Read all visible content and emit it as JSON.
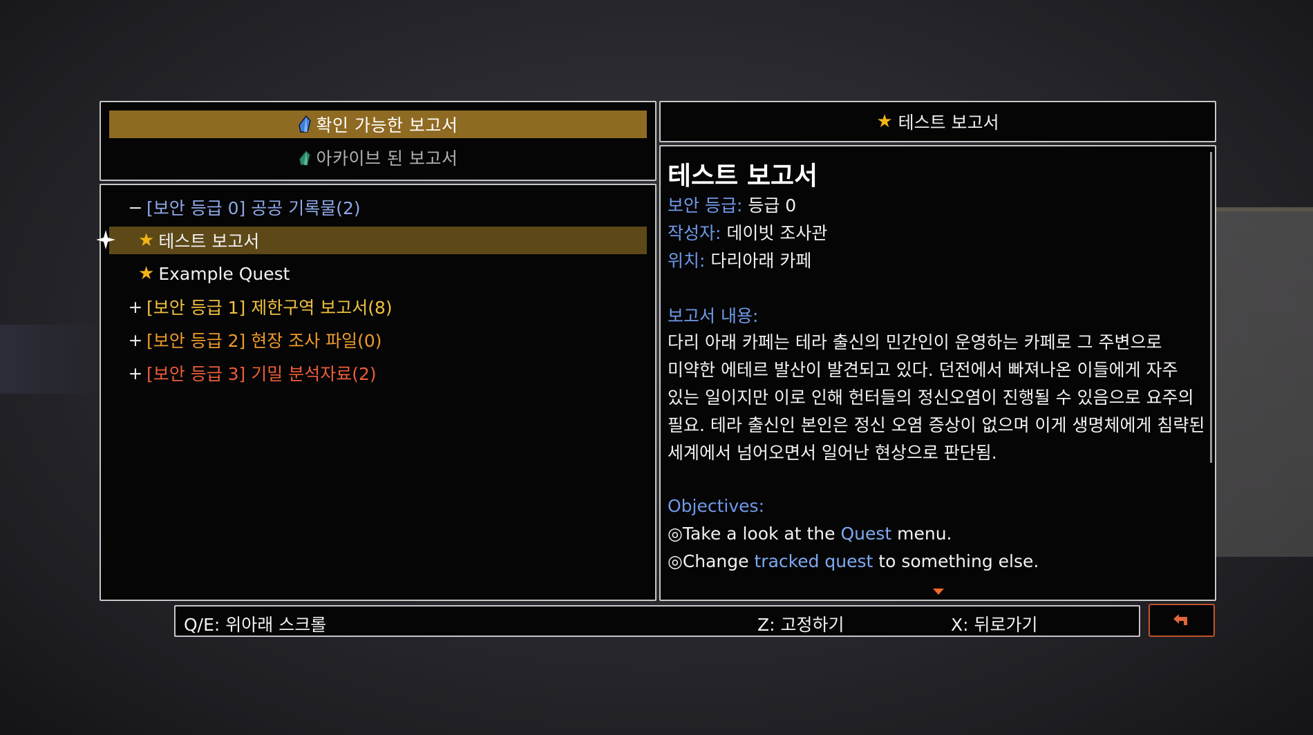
{
  "tabs": {
    "active_label": "확인 가능한 보고서",
    "inactive_label": "아카이브 된 보고서"
  },
  "list": {
    "items": [
      {
        "sign": "−",
        "label": "[보안 등급 0] 공공 기록물(2)"
      },
      {
        "label": "테스트 보고서"
      },
      {
        "label": "Example Quest"
      },
      {
        "sign": "+",
        "label": "[보안 등급 1] 제한구역 보고서(8)"
      },
      {
        "sign": "+",
        "label": "[보안 등급 2] 현장 조사 파일(0)"
      },
      {
        "sign": "+",
        "label": "[보안 등급 3] 기밀 분석자료(2)"
      }
    ]
  },
  "detail": {
    "header": "테스트 보고서",
    "title": "테스트 보고서",
    "security_label": "보안 등급:",
    "security_value": "등급 0",
    "author_label": "작성자:",
    "author_value": "데이빗 조사관",
    "location_label": "위치:",
    "location_value": "다리아래 카페",
    "content_label": "보고서 내용:",
    "content_lines": [
      "다리 아래 카페는 테라 출신의 민간인이 운영하는 카페로 그 주변으로",
      "미약한 에테르 발산이 발견되고 있다. 던전에서 빠져나온 이들에게 자주",
      "있는 일이지만 이로 인해 헌터들의 정신오염이 진행될 수 있음으로 요주의",
      "필요. 테라 출신인 본인은 정신 오염 증상이 없으며 이게 생명체에게 침략된",
      "세계에서 넘어오면서 일어난 현상으로 판단됨."
    ],
    "objectives_label": "Objectives:",
    "objective1": {
      "prefix": "◎Take a look at the ",
      "highlight": "Quest",
      "suffix": " menu."
    },
    "objective2": {
      "prefix": "◎Change ",
      "highlight": "tracked quest",
      "suffix": " to something else."
    }
  },
  "bottom": {
    "scroll_hint": "Q/E: 위아래 스크롤",
    "pin_hint": "Z: 고정하기",
    "back_hint": "X: 뒤로가기"
  },
  "icons": {
    "tab_icon": "crystal-icon",
    "list_cursor": "sparkle-cursor-icon",
    "favorite": "star-icon",
    "back": "back-arrow-icon"
  },
  "colors": {
    "tab_active_bg": "#8f6a22",
    "row_selected_bg": "#5d4818",
    "star": "#f2b418",
    "label_blue": "#6f9ae8",
    "grade0": "#8fa8e8",
    "grade1": "#f0c040",
    "grade2": "#ee9a2a",
    "grade3": "#ee5d3a",
    "back_button_border": "#c2542a"
  }
}
